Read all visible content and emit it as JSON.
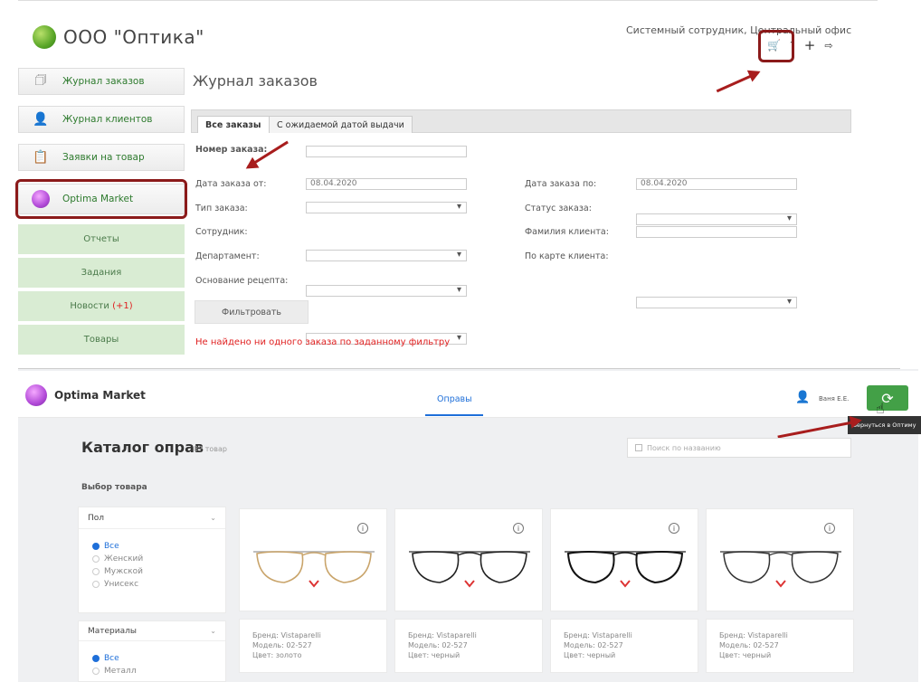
{
  "company": {
    "name": "ООО \"Оптика\""
  },
  "user": {
    "label": "Системный сотрудник, Центральный офис"
  },
  "sidebar": {
    "items": [
      {
        "label": "Журнал заказов"
      },
      {
        "label": "Журнал клиентов"
      },
      {
        "label": "Заявки на товар"
      },
      {
        "label": "Optima Market"
      }
    ],
    "links": [
      {
        "label": "Отчеты"
      },
      {
        "label": "Задания"
      },
      {
        "label": "Новости",
        "badge": "(+1)"
      },
      {
        "label": "Товары"
      }
    ]
  },
  "journal": {
    "title": "Журнал заказов",
    "tabs": [
      {
        "label": "Все заказы"
      },
      {
        "label": "С ожидаемой датой выдачи"
      }
    ],
    "filters": {
      "order_number": {
        "label": "Номер заказа:",
        "value": ""
      },
      "date_from": {
        "label": "Дата заказа от:",
        "value": "08.04.2020"
      },
      "date_to": {
        "label": "Дата заказа по:",
        "value": "08.04.2020"
      },
      "order_type": {
        "label": "Тип заказа:"
      },
      "order_status": {
        "label": "Статус заказа:"
      },
      "employee": {
        "label": "Сотрудник:"
      },
      "client_surname": {
        "label": "Фамилия клиента:"
      },
      "department": {
        "label": "Департамент:"
      },
      "client_card": {
        "label": "По карте клиента:"
      },
      "prescription": {
        "label": "Основание рецепта:"
      }
    },
    "filter_button": "Фильтровать",
    "not_found": "Не найдено ни одного заказа по заданному фильтру"
  },
  "market": {
    "brand": "Optima Market",
    "nav_tab": "Оправы",
    "user_name": "Ваня Е.Е.",
    "return_tooltip": "Вернуться в Оптиму",
    "catalog_title": "Каталог оправ",
    "catalog_count": "87 товар",
    "search_placeholder": "Поиск по названию",
    "select_heading": "Выбор товара",
    "gender": {
      "title": "Пол",
      "options": [
        {
          "label": "Все",
          "selected": true
        },
        {
          "label": "Женский",
          "selected": false
        },
        {
          "label": "Мужской",
          "selected": false
        },
        {
          "label": "Унисекс",
          "selected": false
        }
      ]
    },
    "materials": {
      "title": "Материалы",
      "options": [
        {
          "label": "Все",
          "selected": true
        },
        {
          "label": "Металл",
          "selected": false
        }
      ]
    },
    "products": [
      {
        "brand": "Бренд: Vistaparelli",
        "model": "Модель: 02-527",
        "color": "Цвет: золото"
      },
      {
        "brand": "Бренд: Vistaparelli",
        "model": "Модель: 02-527",
        "color": "Цвет: черный"
      },
      {
        "brand": "Бренд: Vistaparelli",
        "model": "Модель: 02-527",
        "color": "Цвет: черный"
      },
      {
        "brand": "Бренд: Vistaparelli",
        "model": "Модель: 02-527",
        "color": "Цвет: черный"
      }
    ]
  },
  "colors": {
    "accent_red": "#a81d1d",
    "green": "#43a047",
    "link_green": "#2d7a2d",
    "error": "#e02020"
  }
}
